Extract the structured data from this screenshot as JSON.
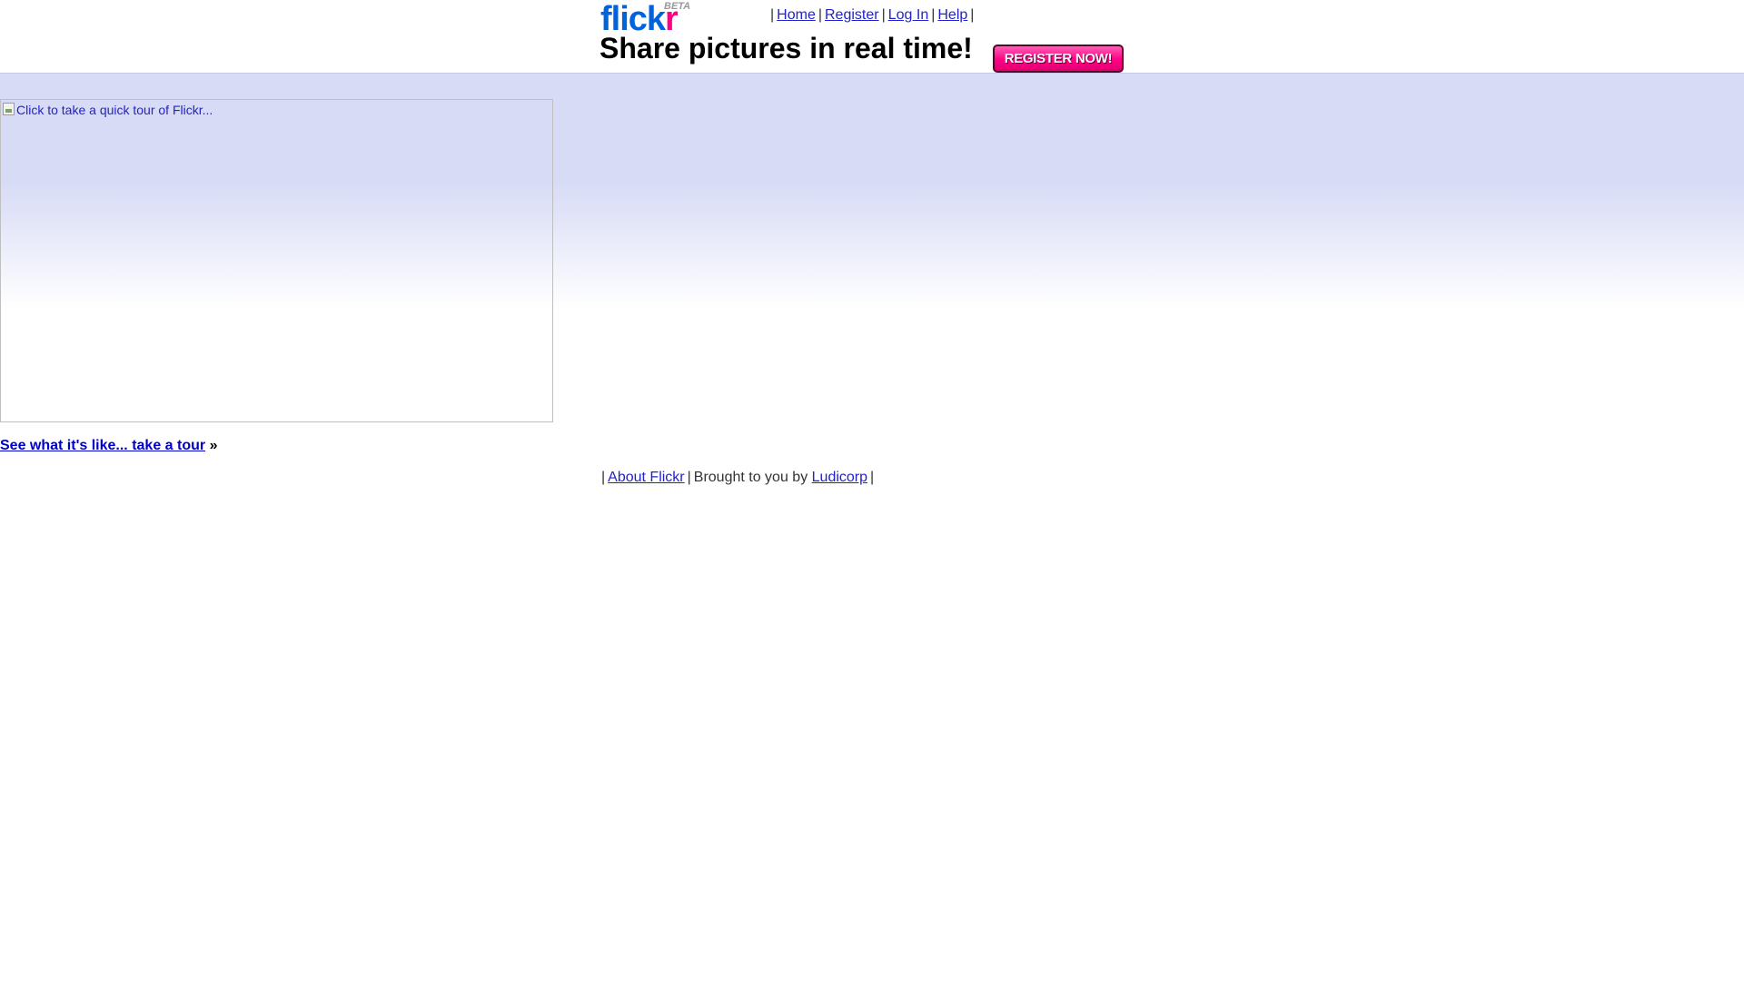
{
  "header": {
    "logo": {
      "part1": "flick",
      "part2": "r",
      "beta": "BETA"
    },
    "nav": {
      "home": "Home",
      "register": "Register",
      "login": "Log In",
      "help": "Help"
    },
    "tagline": "Share pictures in real time!",
    "register_button": "REGISTER NOW!"
  },
  "main": {
    "tour_image_alt": "Click to take a quick tour of Flickr...",
    "tour_link": "See what it's like... take a tour",
    "tour_link_suffix": "»"
  },
  "footer": {
    "about": "About Flickr",
    "brought_by": "Brought to you by",
    "company": "Ludicorp"
  },
  "colors": {
    "brand_blue": "#0063dc",
    "brand_pink": "#ff0084",
    "band_top": "#d7dbf5",
    "link": "#2323c8"
  }
}
